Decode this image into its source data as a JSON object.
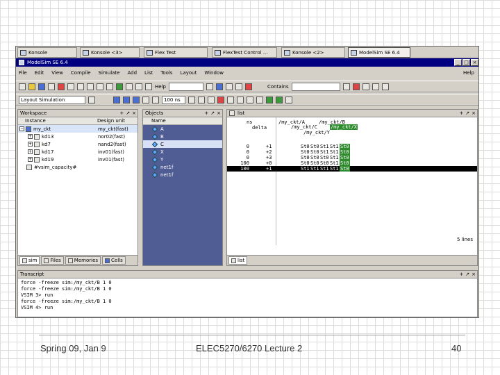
{
  "taskbar": {
    "tasks": [
      {
        "label": "Konsole"
      },
      {
        "label": "Konsole <3>"
      },
      {
        "label": "Flex Test"
      },
      {
        "label": "FlexTest Control ..."
      },
      {
        "label": "Konsole <2>"
      },
      {
        "label": "ModelSim SE 6.4"
      }
    ]
  },
  "window": {
    "title": "ModelSim SE 6.4",
    "menu": [
      "File",
      "Edit",
      "View",
      "Compile",
      "Simulate",
      "Add",
      "List",
      "Tools",
      "Layout",
      "Window"
    ],
    "help": "Help"
  },
  "toolbar": {
    "help_label": "Help",
    "contains_label": "Contains",
    "layout_value": "Layout Simulation",
    "runtime_value": "100 ns"
  },
  "workspace": {
    "title": "Workspace",
    "col_instance": "Instance",
    "col_design_unit": "Design unit",
    "rows": [
      {
        "instance": "my_ckt",
        "unit": "my_ckt(fast)"
      },
      {
        "instance": "kd13",
        "unit": "nor02(fast)"
      },
      {
        "instance": "kd7",
        "unit": "nand2(fast)"
      },
      {
        "instance": "kd17",
        "unit": "inv01(fast)"
      },
      {
        "instance": "kd19",
        "unit": "inv01(fast)"
      },
      {
        "instance": "#vsim_capacity#",
        "unit": ""
      }
    ],
    "tabs": [
      "sim",
      "Files",
      "Memories",
      "Cells"
    ]
  },
  "objects": {
    "title": "Objects",
    "col_name": "Name",
    "items": [
      "A",
      "B",
      "C",
      "X",
      "Y",
      "net1f",
      "net1f"
    ]
  },
  "list": {
    "title": "list",
    "header": [
      "ns",
      "delta",
      "/my_ckt/A",
      "/my_ckt/B",
      "/my_ckt/C",
      "/my_ckt/X",
      "/my_ckt/Y"
    ],
    "rows": [
      {
        "ns": "0",
        "delta": "+1",
        "vals": [
          "St0",
          "St0",
          "St1",
          "St1",
          "St0"
        ]
      },
      {
        "ns": "0",
        "delta": "+2",
        "vals": [
          "St0",
          "St0",
          "St1",
          "St1",
          "St0"
        ]
      },
      {
        "ns": "0",
        "delta": "+3",
        "vals": [
          "St0",
          "St0",
          "St0",
          "St1",
          "St0"
        ]
      },
      {
        "ns": "100",
        "delta": "+0",
        "vals": [
          "St0",
          "St0",
          "St0",
          "St1",
          "St0"
        ]
      },
      {
        "ns": "100",
        "delta": "+1",
        "vals": [
          "St1",
          "St1",
          "St1",
          "St1",
          "St0"
        ]
      }
    ],
    "lines_label": "5 lines",
    "tab": "list"
  },
  "transcript": {
    "title": "Transcript",
    "lines": [
      "force -freeze sim:/my_ckt/B 1 0",
      "force -freeze sim:/my_ckt/B 1 0",
      "VSIM 3> run",
      "force -freeze sim:/my_ckt/B 1 0",
      "VSIM 4> run"
    ]
  },
  "footer": {
    "left": "Spring 09, Jan 9",
    "center": "ELEC5270/6270 Lecture 2",
    "page": "40"
  }
}
